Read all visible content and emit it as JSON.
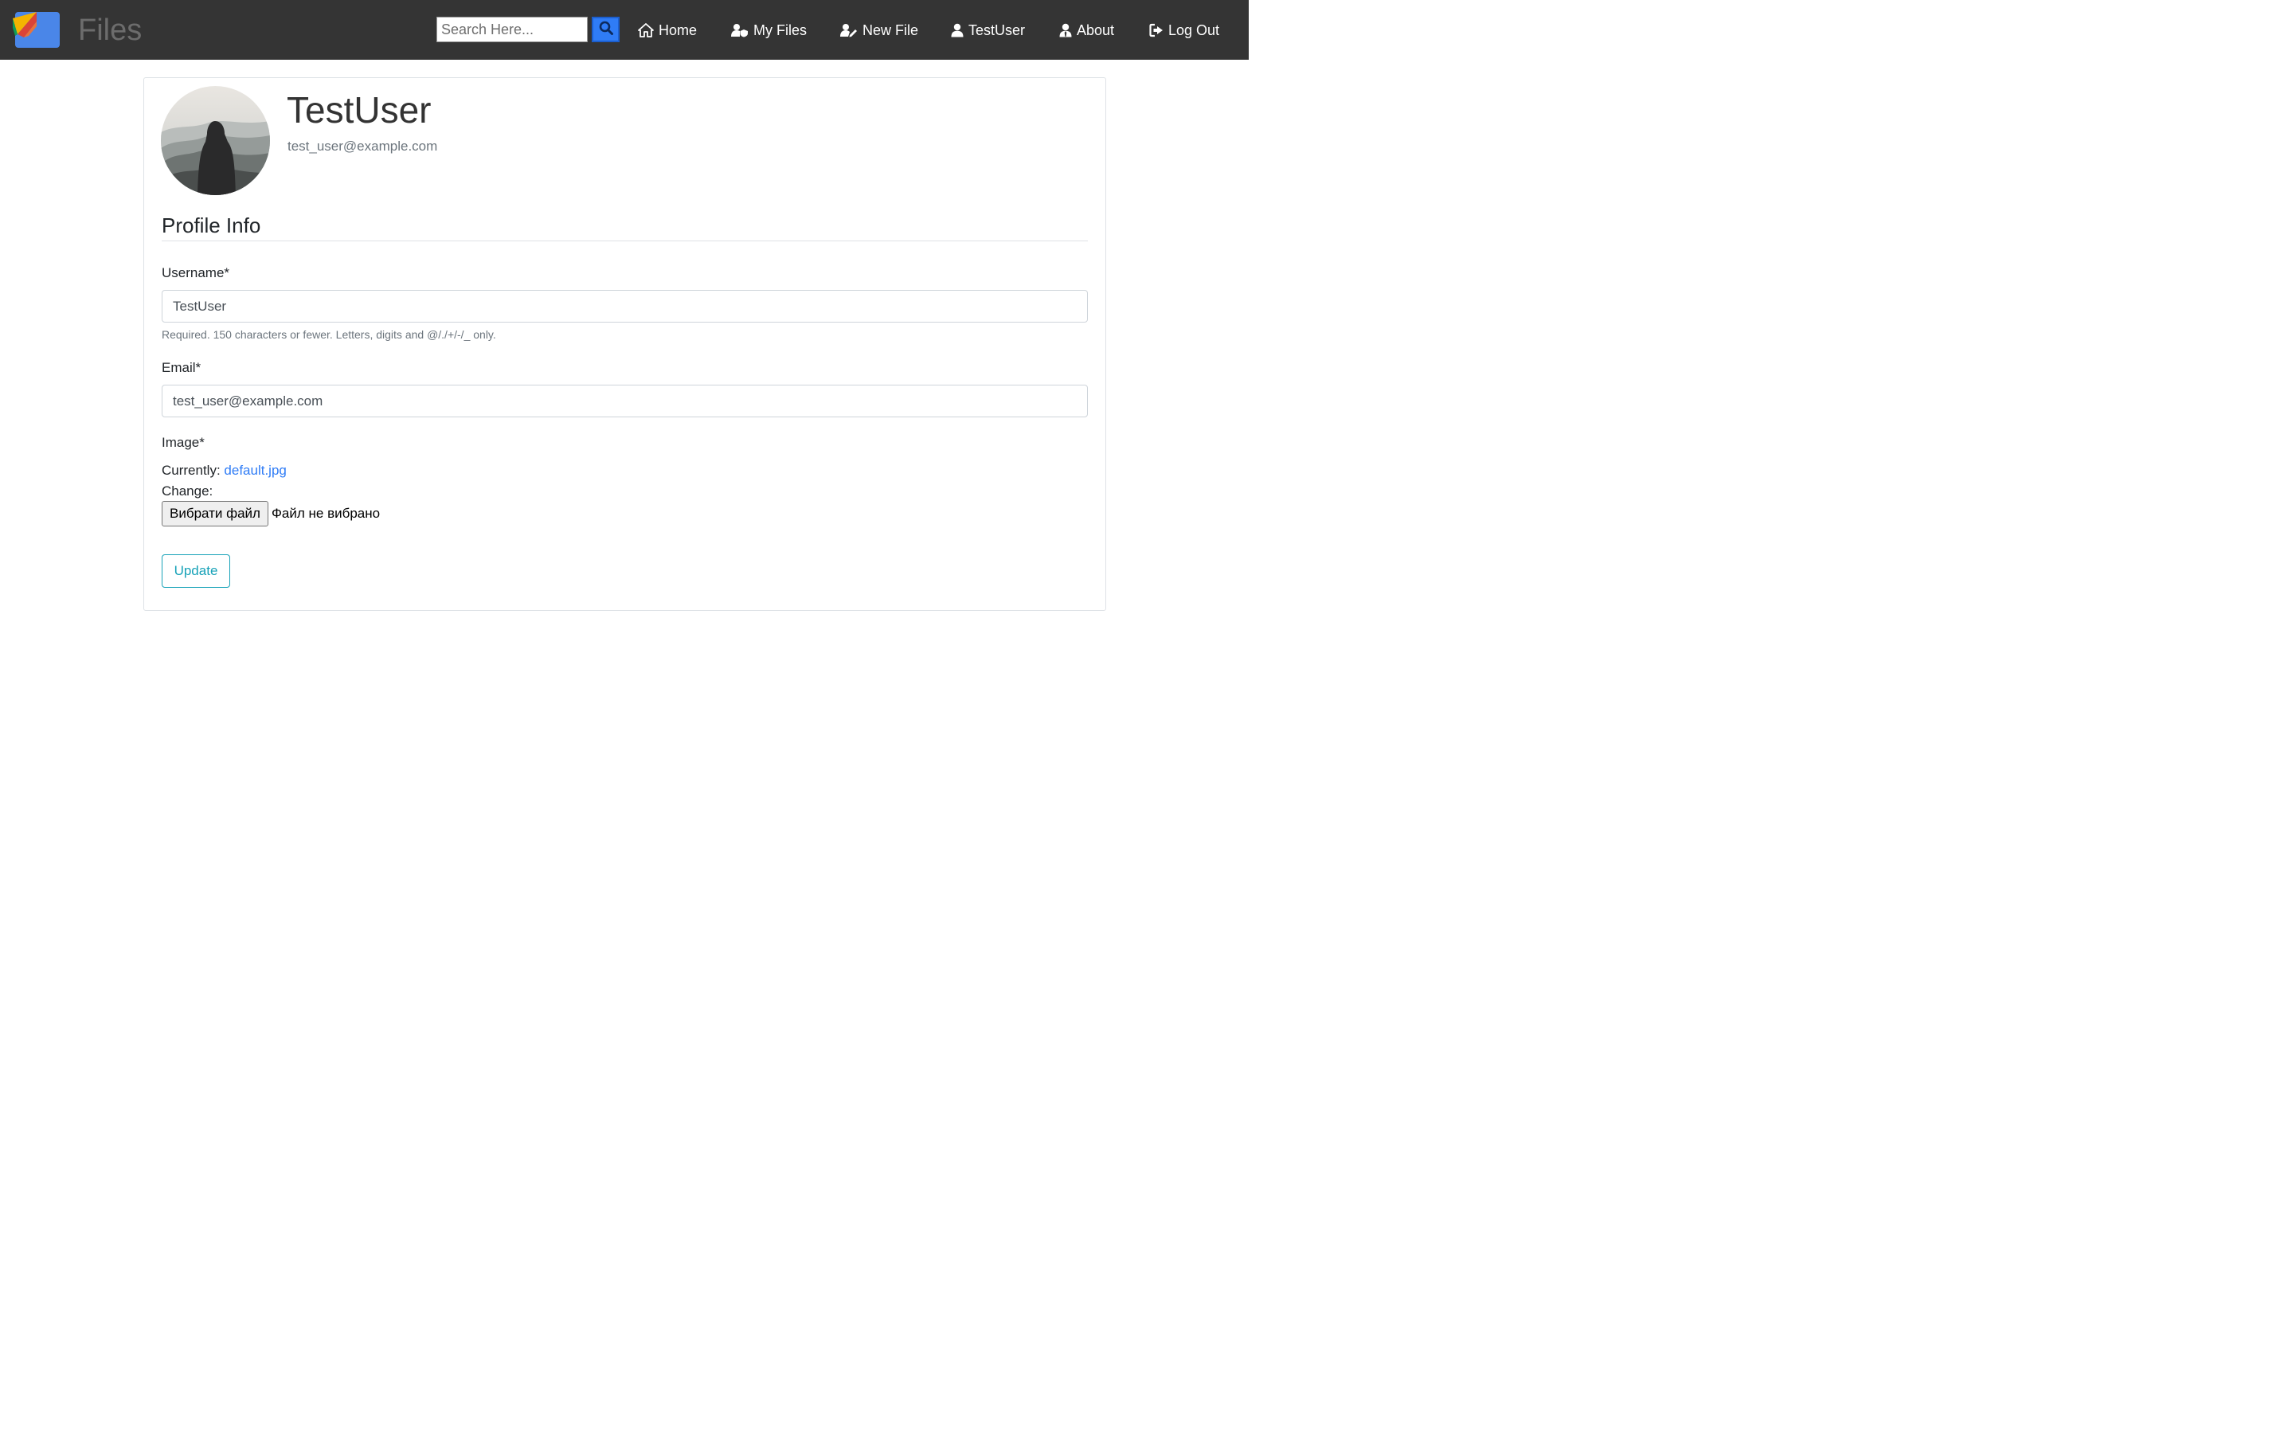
{
  "navbar": {
    "logo_icon": "files-logo-icon",
    "brand": "Files",
    "search": {
      "placeholder": "Search Here...",
      "value": "",
      "button_icon": "search-icon"
    },
    "links": [
      {
        "label": "Home",
        "icon": "home-icon"
      },
      {
        "label": "My Files",
        "icon": "user-shield-icon"
      },
      {
        "label": "New File",
        "icon": "user-edit-icon"
      },
      {
        "label": "TestUser",
        "icon": "user-icon"
      },
      {
        "label": "About",
        "icon": "user-tie-icon"
      },
      {
        "label": "Log Out",
        "icon": "sign-out-icon"
      }
    ]
  },
  "profile": {
    "avatar": "avatar-hooded-figure-mountains",
    "username": "TestUser",
    "email": "test_user@example.com"
  },
  "form": {
    "section_title": "Profile Info",
    "username_label": "Username*",
    "username_value": "TestUser",
    "username_help": "Required. 150 characters or fewer. Letters, digits and @/./+/-/_ only.",
    "email_label": "Email*",
    "email_value": "test_user@example.com",
    "image_label": "Image*",
    "currently_label": "Currently:",
    "current_file": "default.jpg",
    "change_label": "Change:",
    "choose_file_button": "Вибрати файл",
    "no_file_text": "Файл не вибрано",
    "update_button": "Update"
  },
  "colors": {
    "navbar_bg": "#343434",
    "accent_blue": "#2f7cf6",
    "update_teal": "#17a2b8"
  }
}
